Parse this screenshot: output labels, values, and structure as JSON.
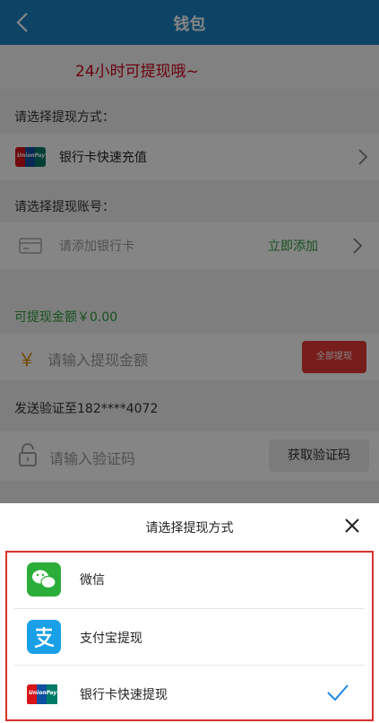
{
  "header": {
    "title": "钱包"
  },
  "notice": {
    "text": "24小时可提现哦~"
  },
  "withdraw_method": {
    "label": "请选择提现方式：",
    "value": "银行卡快速充值",
    "icon": "unionpay-icon"
  },
  "account": {
    "label": "请选择提现账号：",
    "placeholder": "请添加银行卡",
    "action": "立即添加"
  },
  "amount": {
    "available": "可提现金额￥0.00",
    "currency": "￥",
    "placeholder": "请输入提现金额",
    "all_button": "全部提现"
  },
  "verify": {
    "sent_to": "发送验证至182****4072",
    "placeholder": "请输入验证码",
    "get_code": "获取验证码"
  },
  "sheet": {
    "title": "请选择提现方式",
    "options": [
      {
        "label": "微信",
        "icon": "wechat-icon",
        "selected": false
      },
      {
        "label": "支付宝提现",
        "icon": "alipay-icon",
        "selected": false
      },
      {
        "label": "银行卡快速提现",
        "icon": "unionpay-icon",
        "selected": true
      }
    ]
  },
  "colors": {
    "header": "#1a82c4",
    "notice_text": "#d0021b",
    "green": "#2e9c3a",
    "all_button": "#e53935",
    "highlight_border": "#d6322b",
    "check": "#1e88e5"
  }
}
